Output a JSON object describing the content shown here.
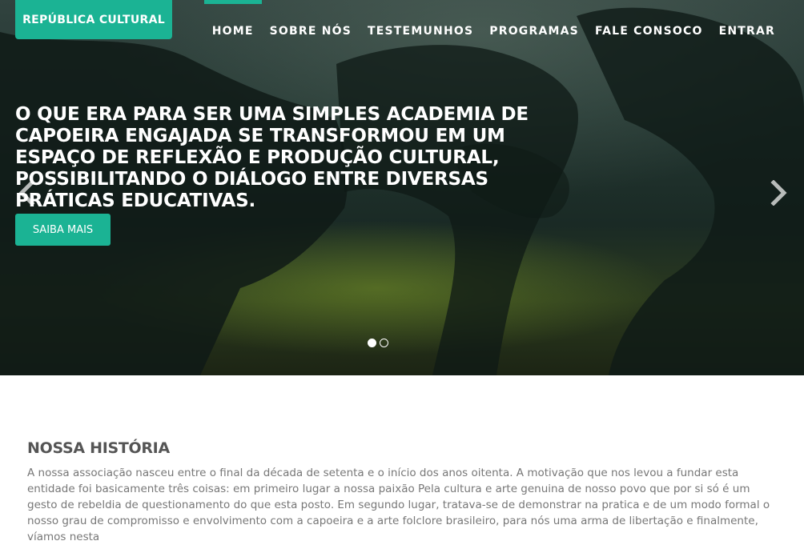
{
  "header": {
    "brand": "REPÚBLICA CULTURAL",
    "nav": [
      "HOME",
      "SOBRE NÓS",
      "TESTEMUNHOS",
      "PROGRAMAS",
      "FALE CONSOCO",
      "ENTRAR"
    ],
    "active_nav": "HOME"
  },
  "hero": {
    "headline": "O QUE ERA PARA SER UMA SIMPLES ACADEMIA DE CAPOEIRA ENGAJADA SE TRANSFORMOU EM UM ESPAÇO DE REFLEXÃO E PRODUÇÃO CULTURAL, POSSIBILITANDO O DIÁLOGO ENTRE DIVERSAS PRÁTICAS EDUCATIVAS.",
    "cta_label": "SAIBA MAIS",
    "prev_icon": "chevron-left-icon",
    "next_icon": "chevron-right-icon",
    "slides_total": 2,
    "active_slide": 1
  },
  "section": {
    "title": "NOSSA HISTÓRIA",
    "body": "A nossa associação nasceu entre o final da década de setenta e o início dos anos oitenta. A motivação que nos levou a fundar esta entidade foi basicamente três coisas: em primeiro lugar a nossa paixão Pela cultura e arte genuina de nosso povo que por si só é um gesto de rebeldia de questionamento do que esta posto. Em segundo lugar, tratava-se de demonstrar na pratica e de um modo formal o nosso grau de compromisso e envolvimento com a capoeira e a arte folclore brasileiro, para nós uma arma de libertação e finalmente, víamos nesta"
  },
  "colors": {
    "accent": "#1bb394",
    "heading": "#555555",
    "body_text": "#777777"
  }
}
